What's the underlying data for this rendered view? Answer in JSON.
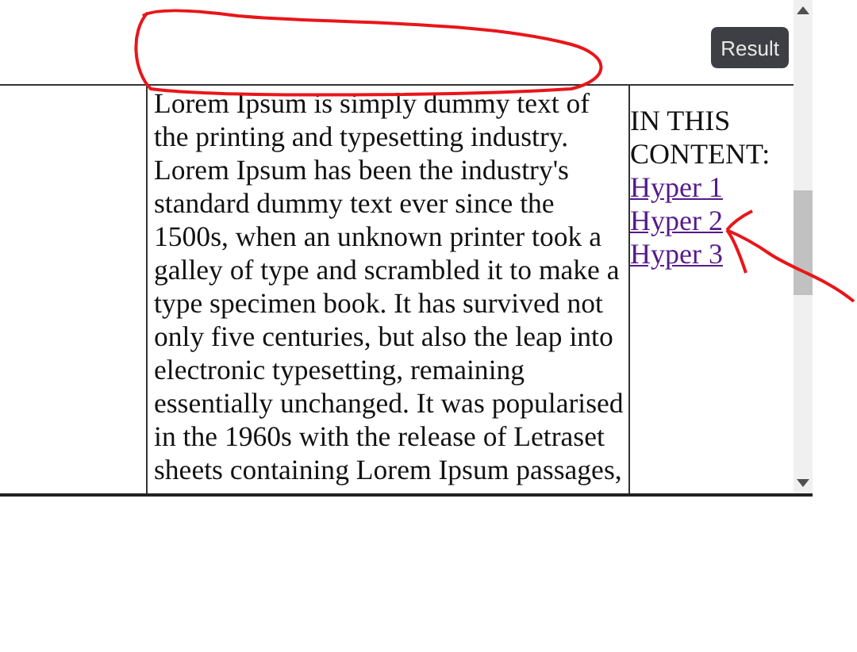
{
  "result_button": "Result",
  "content_cell": {
    "text": "Lorem Ipsum is simply dummy text of the printing and typesetting industry. Lorem Ipsum has been the industry's standard dummy text ever since the 1500s, when an unknown printer took a galley of type and scrambled it to make a type specimen book. It has survived not only five centuries, but also the leap into electronic typesetting, remaining essentially unchanged. It was popularised in the 1960s with the release of Letraset sheets containing Lorem Ipsum passages,"
  },
  "sidebar_cell": {
    "heading": "IN THIS CONTENT:",
    "links": [
      "Hyper 1",
      "Hyper 2",
      "Hyper 3"
    ]
  }
}
